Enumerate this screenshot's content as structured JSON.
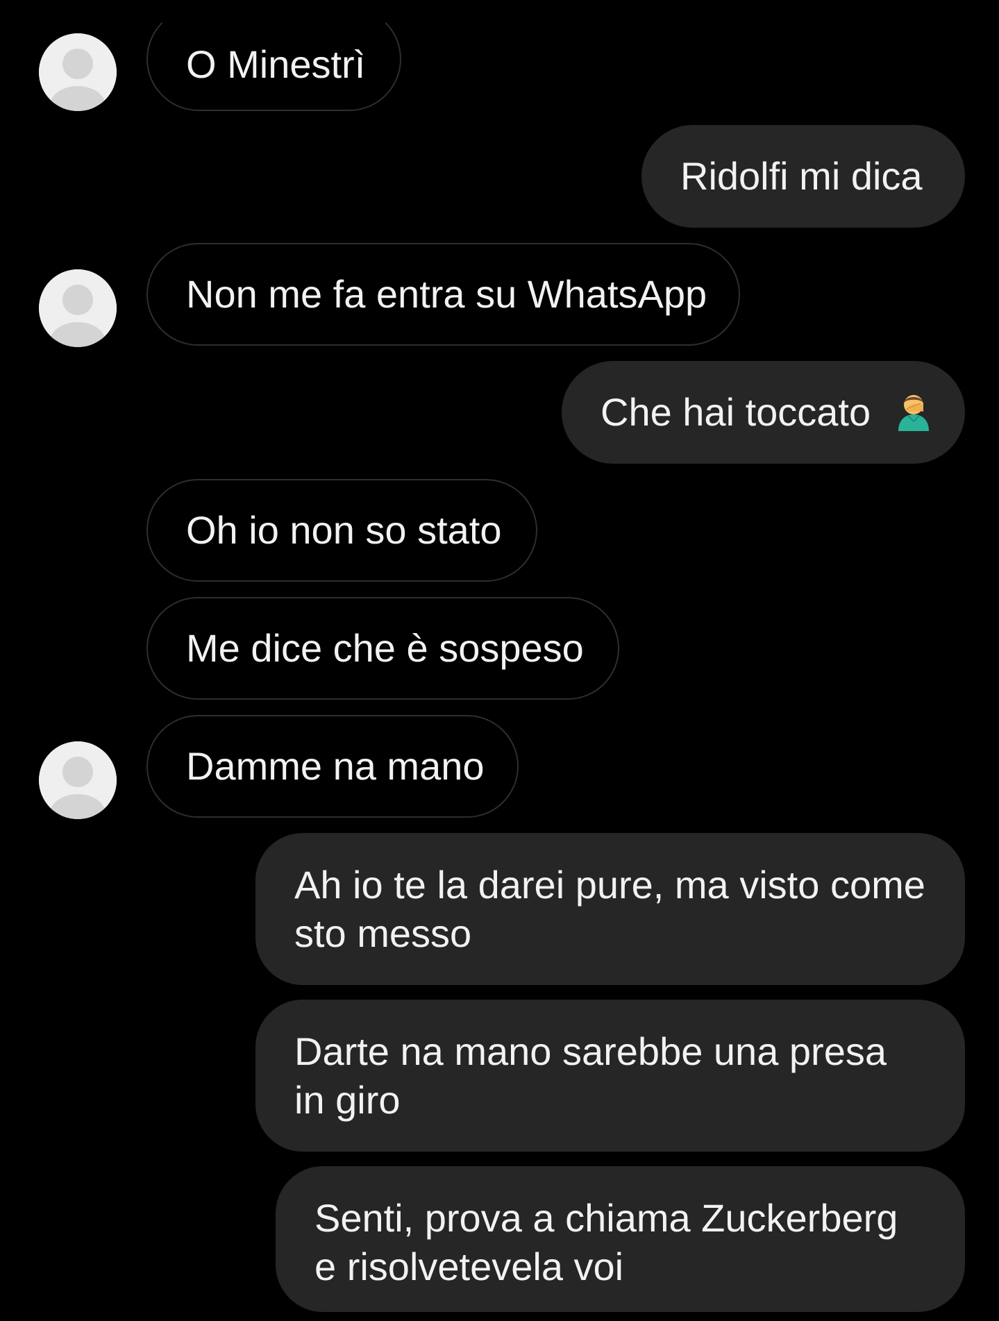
{
  "messages": [
    {
      "text": "O Minestrì"
    },
    {
      "text": "Ridolfi mi dica"
    },
    {
      "text": "Non me fa entra su WhatsApp"
    },
    {
      "text": "Che hai toccato",
      "emoji": "man-facepalming-icon"
    },
    {
      "text": "Oh io non so stato"
    },
    {
      "text": "Me dice che è sospeso"
    },
    {
      "text": "Damme na mano"
    },
    {
      "text": "Ah io te la darei pure, ma visto come sto messo"
    },
    {
      "text": "Darte na mano sarebbe una presa in giro"
    },
    {
      "text": "Senti, prova a chiama Zuckerberg e risolvetevela voi"
    }
  ],
  "colors": {
    "background": "#000000",
    "incoming_border": "#2e2e2e",
    "outgoing_bubble": "#262626",
    "text": "#f2f2f2",
    "avatar_bg": "#efefef",
    "avatar_fg": "#d4d4d4"
  }
}
